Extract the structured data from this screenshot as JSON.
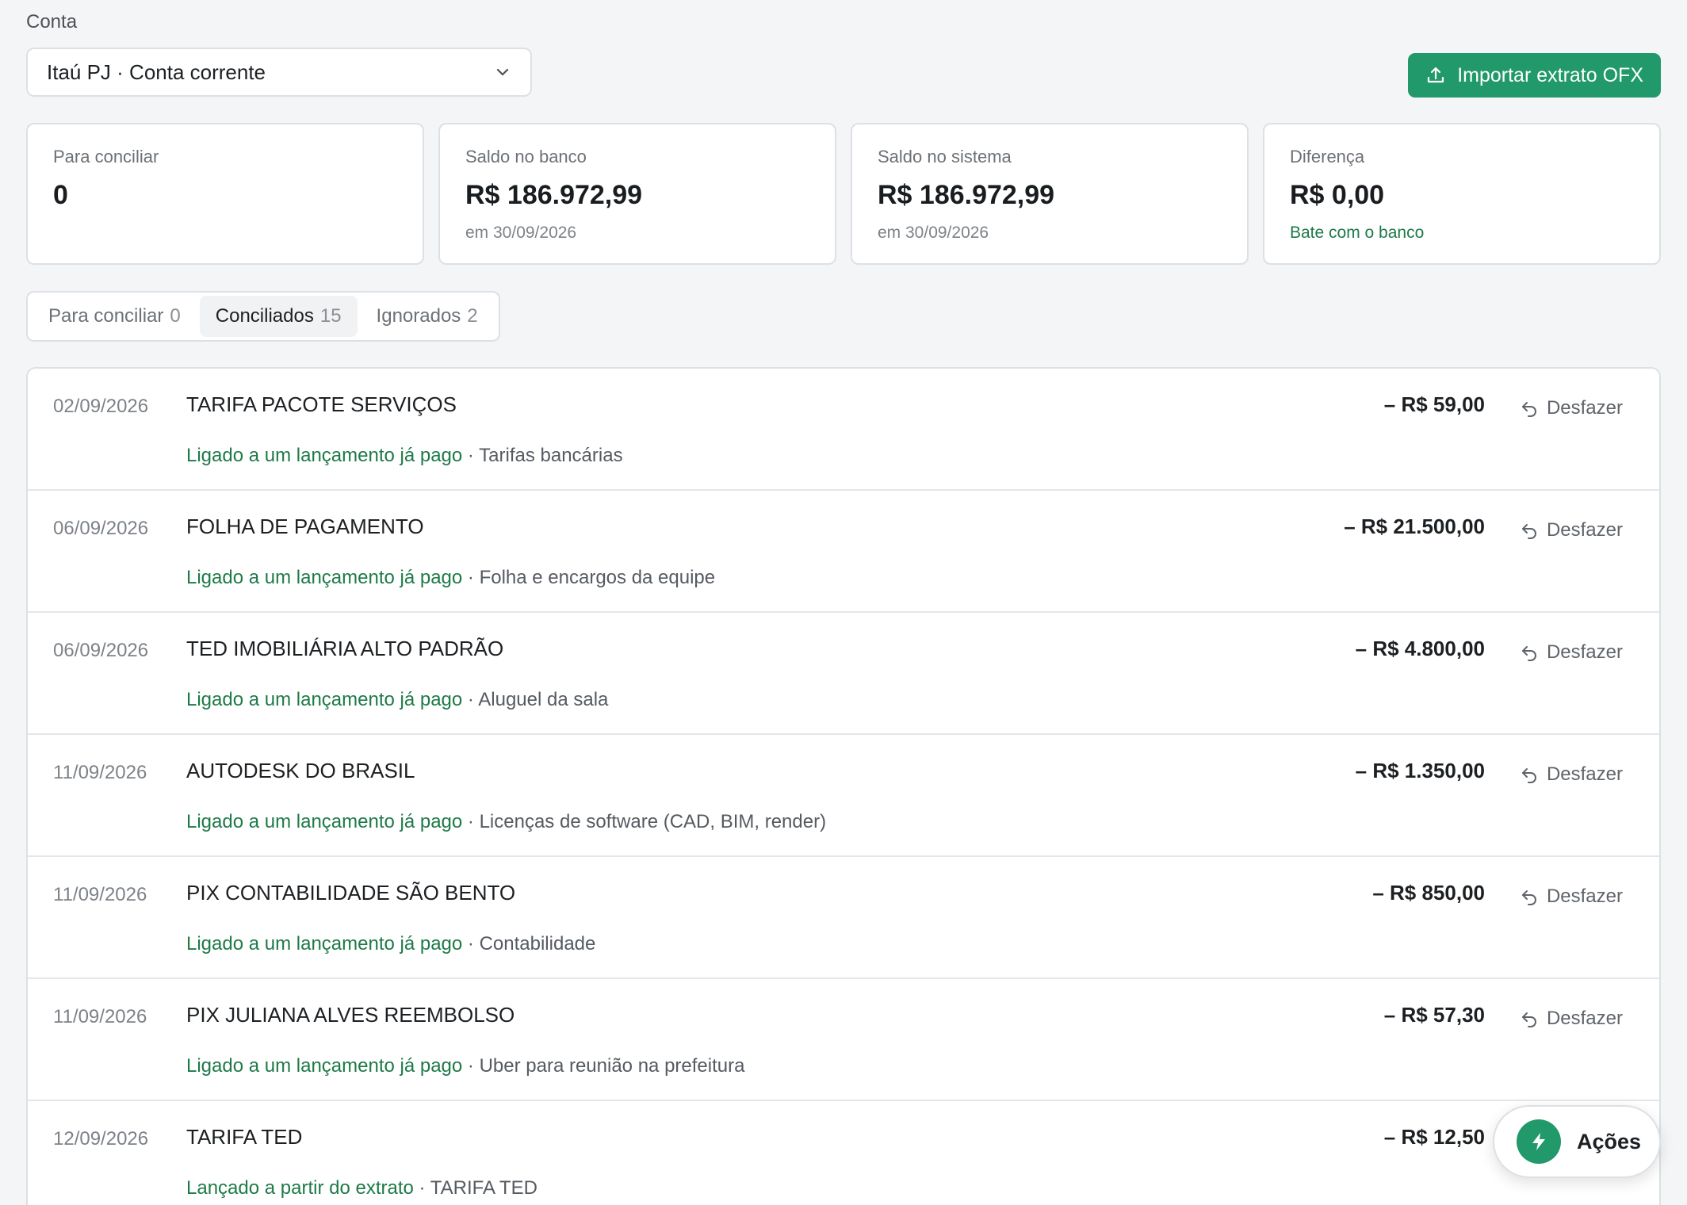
{
  "account": {
    "label": "Conta",
    "selected": "Itaú PJ · Conta corrente"
  },
  "import_button": {
    "label": "Importar extrato OFX"
  },
  "cards": [
    {
      "label": "Para conciliar",
      "value": "0",
      "sub": ""
    },
    {
      "label": "Saldo no banco",
      "value": "R$ 186.972,99",
      "sub": "em 30/09/2026"
    },
    {
      "label": "Saldo no sistema",
      "value": "R$ 186.972,99",
      "sub": "em 30/09/2026"
    },
    {
      "label": "Diferença",
      "value": "R$ 0,00",
      "sub": "Bate com o banco"
    }
  ],
  "tabs": [
    {
      "label": "Para conciliar",
      "count": "0"
    },
    {
      "label": "Conciliados",
      "count": "15"
    },
    {
      "label": "Ignorados",
      "count": "2"
    }
  ],
  "undo_label": "Desfazer",
  "rows": [
    {
      "date": "02/09/2026",
      "desc": "TARIFA PACOTE SERVIÇOS",
      "amount": "– R$ 59,00",
      "link": "Ligado a um lançamento já pago",
      "sep": " · ",
      "category": "Tarifas bancárias"
    },
    {
      "date": "06/09/2026",
      "desc": "FOLHA DE PAGAMENTO",
      "amount": "– R$ 21.500,00",
      "link": "Ligado a um lançamento já pago",
      "sep": " · ",
      "category": "Folha e encargos da equipe"
    },
    {
      "date": "06/09/2026",
      "desc": "TED IMOBILIÁRIA ALTO PADRÃO",
      "amount": "– R$ 4.800,00",
      "link": "Ligado a um lançamento já pago",
      "sep": " · ",
      "category": "Aluguel da sala"
    },
    {
      "date": "11/09/2026",
      "desc": "AUTODESK DO BRASIL",
      "amount": "– R$ 1.350,00",
      "link": "Ligado a um lançamento já pago",
      "sep": " · ",
      "category": "Licenças de software (CAD, BIM, render)"
    },
    {
      "date": "11/09/2026",
      "desc": "PIX CONTABILIDADE SÃO BENTO",
      "amount": "– R$ 850,00",
      "link": "Ligado a um lançamento já pago",
      "sep": " · ",
      "category": "Contabilidade"
    },
    {
      "date": "11/09/2026",
      "desc": "PIX JULIANA ALVES REEMBOLSO",
      "amount": "– R$ 57,30",
      "link": "Ligado a um lançamento já pago",
      "sep": " · ",
      "category": "Uber para reunião na prefeitura"
    },
    {
      "date": "12/09/2026",
      "desc": "TARIFA TED",
      "amount": "– R$ 12,50",
      "link": "Lançado a partir do extrato",
      "sep": " · ",
      "category": "TARIFA TED"
    }
  ],
  "actions_fab": {
    "label": "Ações"
  },
  "colors": {
    "accent": "#21996a",
    "link_green": "#1e7a47"
  },
  "icons": {
    "select": "chevron-down-icon",
    "import": "upload-icon",
    "undo": "undo-icon",
    "actions": "bolt-icon"
  }
}
